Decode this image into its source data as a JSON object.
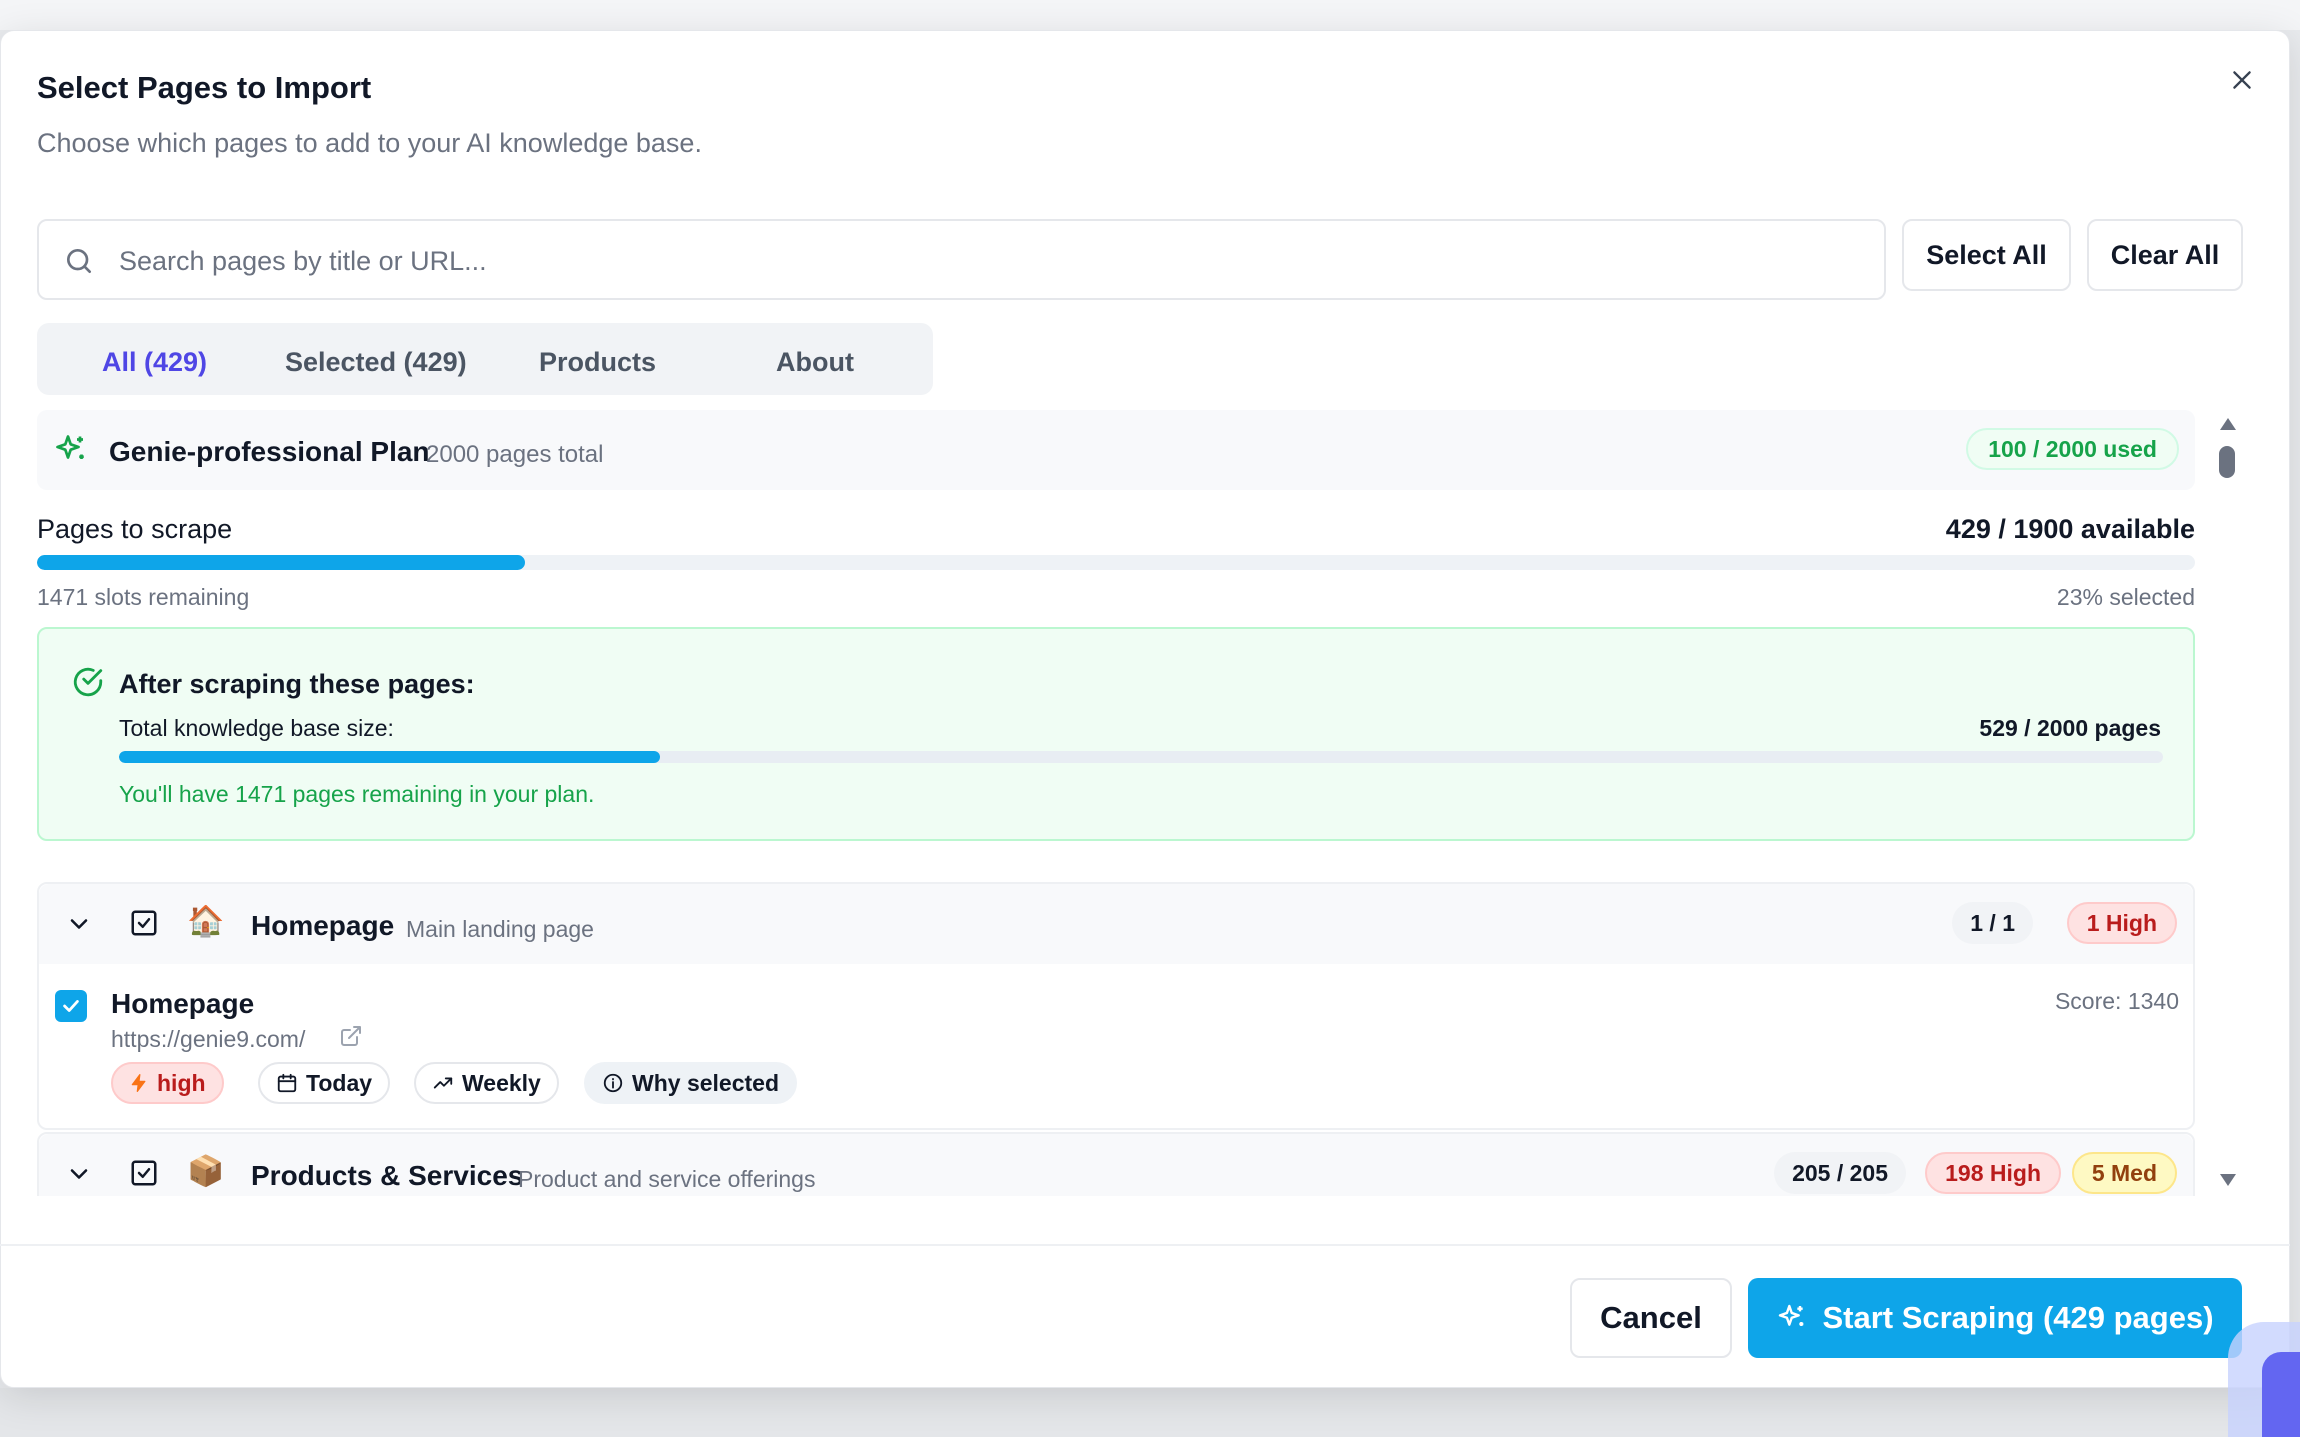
{
  "dialog": {
    "title": "Select Pages to Import",
    "subtitle": "Choose which pages to add to your AI knowledge base."
  },
  "search": {
    "placeholder": "Search pages by title or URL...",
    "value": ""
  },
  "actions": {
    "select_all": "Select All",
    "clear_all": "Clear All"
  },
  "tabs": [
    {
      "label": "All (429)",
      "active": true
    },
    {
      "label": "Selected (429)",
      "active": false
    },
    {
      "label": "Products",
      "active": false
    },
    {
      "label": "About",
      "active": false
    }
  ],
  "plan": {
    "name": "Genie-professional Plan",
    "total": "2000 pages total",
    "used": "100 / 2000 used"
  },
  "scrape": {
    "label": "Pages to scrape",
    "available": "429 / 1900 available",
    "progress": 0.226,
    "slots_remaining": "1471 slots remaining",
    "percent_selected": "23% selected"
  },
  "after": {
    "title": "After scraping these pages:",
    "kb_label": "Total knowledge base size:",
    "kb_value": "529 / 2000 pages",
    "kb_progress": 0.2645,
    "remaining_note": "You'll have 1471 pages remaining in your plan."
  },
  "groups": [
    {
      "emoji": "🏠",
      "name": "Homepage",
      "description": "Main landing page",
      "count": "1 / 1",
      "high": "1 High",
      "pages": [
        {
          "title": "Homepage",
          "url": "https://genie9.com/",
          "score": "Score: 1340",
          "priority": "high",
          "date": "Today",
          "frequency": "Weekly",
          "why": "Why selected"
        }
      ]
    },
    {
      "emoji": "📦",
      "name": "Products & Services",
      "description": "Product and service offerings",
      "count": "205 / 205",
      "high": "198 High",
      "med": "5 Med"
    }
  ],
  "footer": {
    "cancel": "Cancel",
    "start": "Start Scraping (429 pages)"
  },
  "colors": {
    "accent": "#0ea5e9",
    "tab_active": "#4f46e5",
    "success": "#16a34a",
    "danger": "#b91c1c"
  },
  "icons": [
    "close-icon",
    "search-icon",
    "sparkles-icon",
    "check-circle-icon",
    "chevron-down-icon",
    "checkbox-checked-icon",
    "external-link-icon",
    "zap-icon",
    "calendar-icon",
    "trending-up-icon",
    "info-icon"
  ]
}
